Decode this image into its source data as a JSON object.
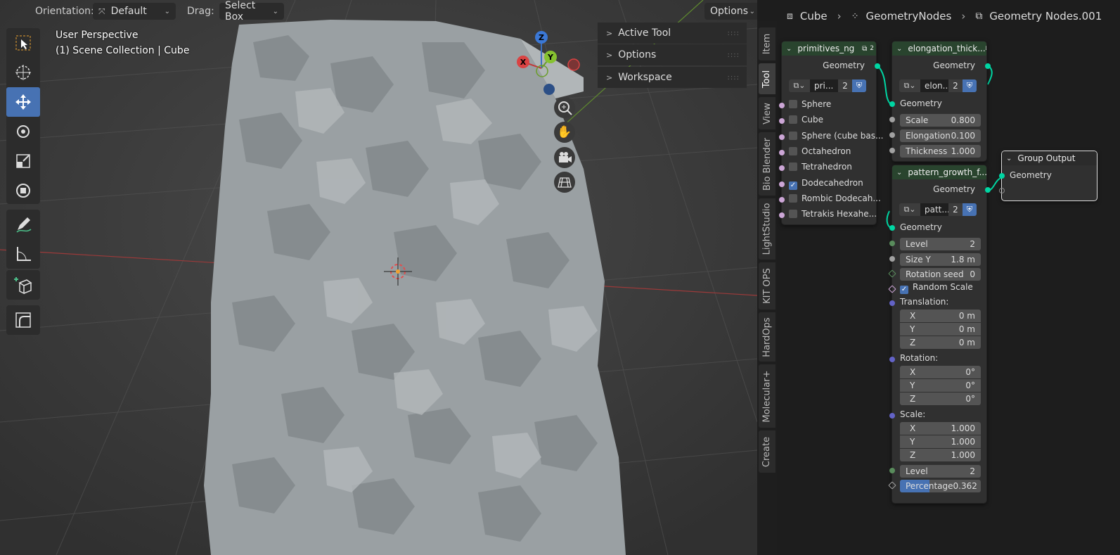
{
  "header": {
    "orientation_label": "Orientation:",
    "orientation_value": "Default",
    "drag_label": "Drag:",
    "drag_value": "Select Box",
    "options_label": "Options"
  },
  "viewport": {
    "perspective": "User Perspective",
    "collection": "(1) Scene Collection | Cube",
    "gizmo": {
      "x": "X",
      "y": "Y",
      "z": "Z"
    }
  },
  "npanel": {
    "sections": [
      "Active Tool",
      "Options",
      "Workspace"
    ]
  },
  "sidebar_tabs": [
    "Item",
    "Tool",
    "View",
    "Bio Blender",
    "LightStudio",
    "KIT OPS",
    "HardOps",
    "Molecular+",
    "Create"
  ],
  "breadcrumb": [
    "Cube",
    "GeometryNodes",
    "Geometry Nodes.001"
  ],
  "nodes": {
    "primitives": {
      "title": "primitives_ng",
      "users": "2",
      "output": "Geometry",
      "group_name": "pri...",
      "group_count": "2",
      "items": [
        {
          "label": "Sphere",
          "checked": false
        },
        {
          "label": "Cube",
          "checked": false
        },
        {
          "label": "Sphere (cube bas...",
          "checked": false
        },
        {
          "label": "Octahedron",
          "checked": false
        },
        {
          "label": "Tetrahedron",
          "checked": false
        },
        {
          "label": "Dodecahedron",
          "checked": true
        },
        {
          "label": "Rombic Dodecah...",
          "checked": false
        },
        {
          "label": "Tetrakis Hexahe...",
          "checked": false
        }
      ]
    },
    "elongation": {
      "title": "elongation_thick...",
      "users": "2",
      "output": "Geometry",
      "group_name": "elon...",
      "group_count": "2",
      "input": "Geometry",
      "fields": [
        {
          "label": "Scale",
          "value": "0.800"
        },
        {
          "label": "Elongation",
          "value": "0.100"
        },
        {
          "label": "Thickness",
          "value": "1.000"
        }
      ]
    },
    "pattern": {
      "title": "pattern_growth_f...",
      "users": "2",
      "output": "Geometry",
      "group_name": "patt...",
      "group_count": "2",
      "input": "Geometry",
      "level": {
        "label": "Level",
        "value": "2"
      },
      "size_y": {
        "label": "Size Y",
        "value": "1.8 m"
      },
      "rotation_seed": {
        "label": "Rotation seed",
        "value": "0"
      },
      "random_scale": "Random Scale",
      "translation_label": "Translation:",
      "translation": [
        {
          "label": "X",
          "value": "0 m"
        },
        {
          "label": "Y",
          "value": "0 m"
        },
        {
          "label": "Z",
          "value": "0 m"
        }
      ],
      "rotation_label": "Rotation:",
      "rotation": [
        {
          "label": "X",
          "value": "0°"
        },
        {
          "label": "Y",
          "value": "0°"
        },
        {
          "label": "Z",
          "value": "0°"
        }
      ],
      "scale_label": "Scale:",
      "scale": [
        {
          "label": "X",
          "value": "1.000"
        },
        {
          "label": "Y",
          "value": "1.000"
        },
        {
          "label": "Z",
          "value": "1.000"
        }
      ],
      "level2": {
        "label": "Level",
        "value": "2"
      },
      "percentage": {
        "label": "Percentage",
        "value": "0.362",
        "fraction": 0.362
      }
    },
    "group_output": {
      "title": "Group Output",
      "input": "Geometry"
    }
  },
  "colors": {
    "accent": "#4772b3",
    "geometry_socket": "#00d6a3",
    "float_socket": "#a1a1a1",
    "int_socket": "#598c5c",
    "vector_socket": "#6363c7",
    "bool_socket": "#cca6d6"
  }
}
